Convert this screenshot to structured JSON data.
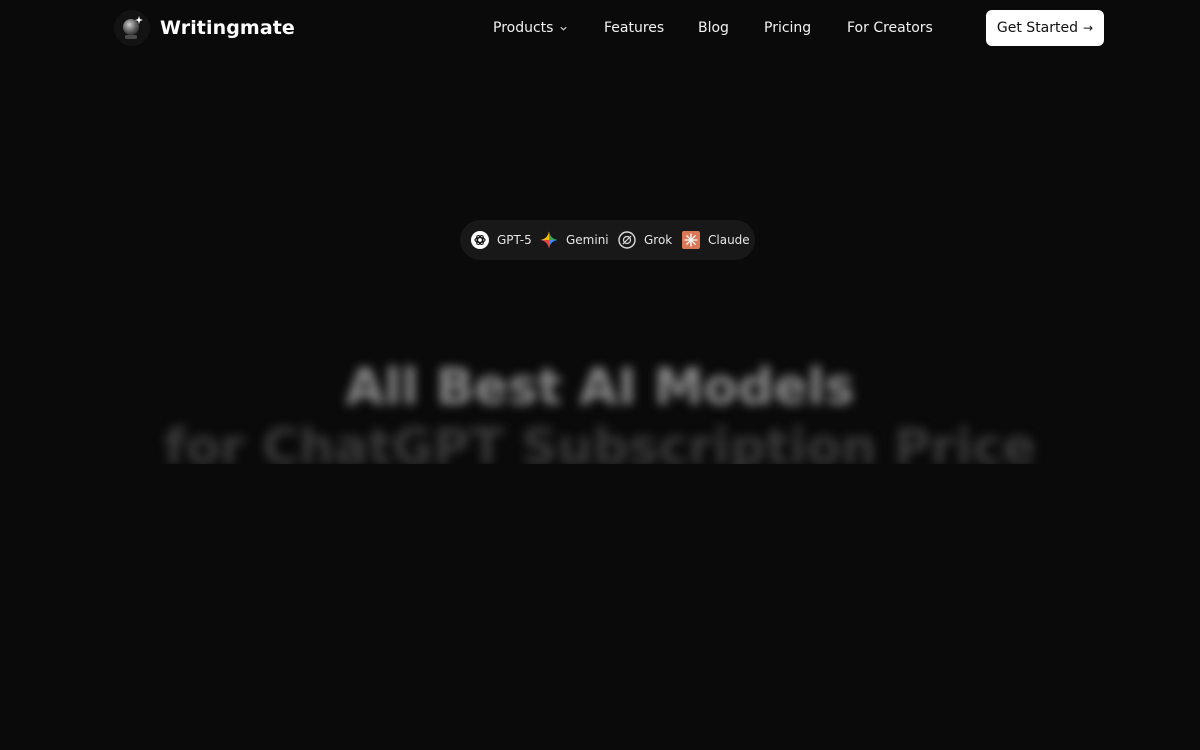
{
  "header": {
    "brand": "Writingmate",
    "nav": [
      {
        "label": "Products",
        "has_dropdown": true
      },
      {
        "label": "Features"
      },
      {
        "label": "Blog"
      },
      {
        "label": "Pricing"
      },
      {
        "label": "For Creators"
      }
    ],
    "cta_label": "Get Started",
    "cta_arrow": "→"
  },
  "models": [
    {
      "label": "GPT-5",
      "icon": "openai-icon"
    },
    {
      "label": "Gemini",
      "icon": "gemini-icon"
    },
    {
      "label": "Grok",
      "icon": "grok-icon"
    },
    {
      "label": "Claude",
      "icon": "claude-icon"
    }
  ],
  "hero": {
    "title": "All Best AI Models",
    "subtitle": "for ChatGPT Subscription Price"
  },
  "colors": {
    "background": "#0a0a0a",
    "cta_background": "#ffffff",
    "pill_background": "#181818",
    "claude_accent": "#d97757"
  }
}
